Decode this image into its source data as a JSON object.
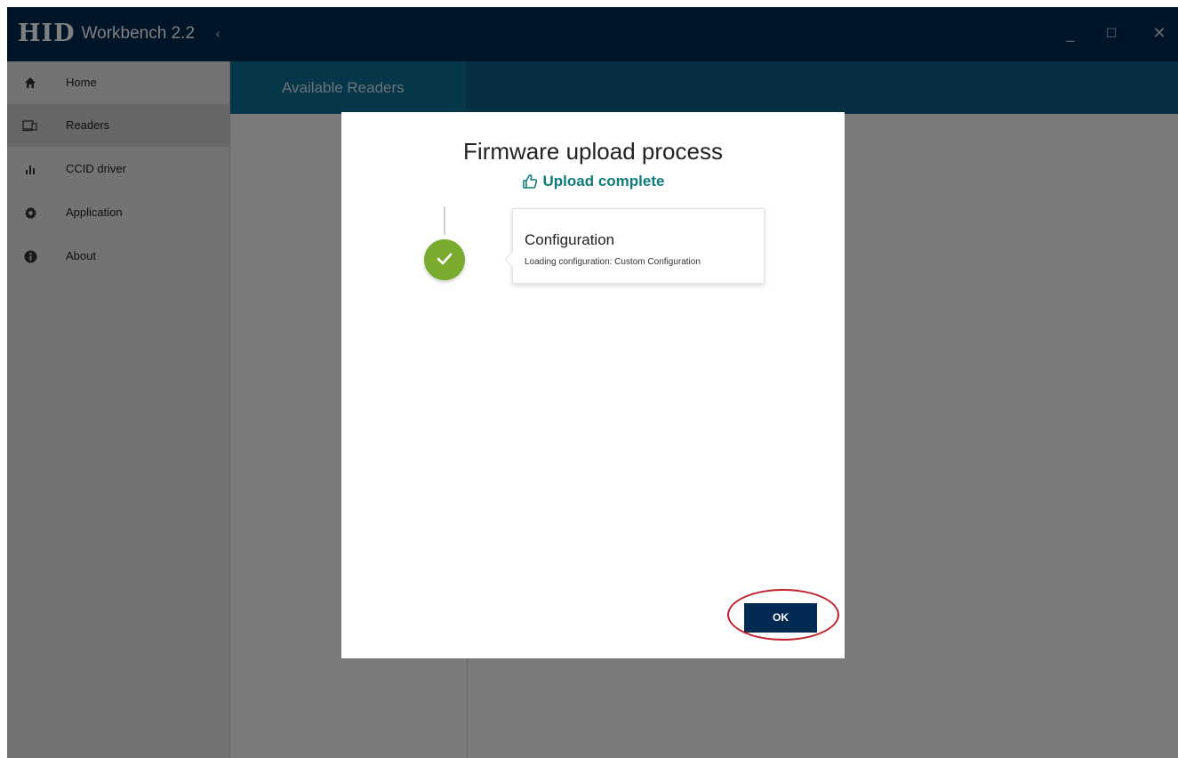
{
  "app": {
    "brand": "HID",
    "product": "Workbench 2.2",
    "collapse_glyph": "‹"
  },
  "window_controls": {
    "minimize": "_",
    "maximize": "☐",
    "close": "✕"
  },
  "sidebar": {
    "items": [
      {
        "label": "Home",
        "icon": "home-icon",
        "active": false
      },
      {
        "label": "Readers",
        "icon": "readers-icon",
        "active": true
      },
      {
        "label": "CCID driver",
        "icon": "bar-chart-icon",
        "active": false
      },
      {
        "label": "Application",
        "icon": "gear-icon",
        "active": false
      },
      {
        "label": "About",
        "icon": "info-icon",
        "active": false
      }
    ]
  },
  "content": {
    "panel_title": "Available Readers"
  },
  "dialog": {
    "title": "Firmware upload process",
    "status": "Upload complete",
    "status_icon": "thumbs-up-icon",
    "step": {
      "title": "Configuration",
      "description": "Loading configuration: Custom Configuration",
      "state": "complete"
    },
    "ok_label": "OK"
  },
  "colors": {
    "titlebar": "#002a51",
    "content_header": "#0c5f84",
    "success_green": "#7aaa2e",
    "status_teal": "#0f7c7c",
    "highlight_red": "#c0202a"
  }
}
